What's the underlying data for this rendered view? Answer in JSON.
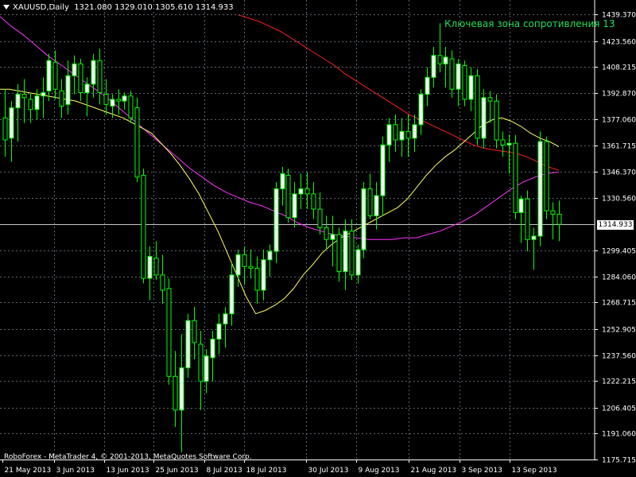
{
  "header": {
    "symbol": "XAUUSD,Daily",
    "ohlc": "1321.080 1329.010 1305.610 1314.933"
  },
  "annotation": "Ключевая зона сопротивления 13",
  "copyright": "RoboForex - MetaTrader 4, © 2001-2013, MetaQuotes Software Corp.",
  "colors": {
    "background": "#000000",
    "grid": "#5a6470",
    "bull_candle": "#ffffff",
    "bear_candle": "#000000",
    "wick": "#00ff00",
    "ma_fast": "#ffff66",
    "ma_mid": "#ff33ff",
    "ma_slow": "#ff2020",
    "annotation": "#22dd55"
  },
  "chart_data": {
    "type": "candlestick",
    "ylim": [
      1175.71,
      1439.37
    ],
    "current_price": "1314.933",
    "y_ticks": [
      "1439.370",
      "1423.560",
      "1408.215",
      "1392.870",
      "1377.060",
      "1361.715",
      "1346.370",
      "1330.560",
      "1314.933",
      "1299.405",
      "1284.060",
      "1268.715",
      "1252.905",
      "1237.560",
      "1222.215",
      "1206.405",
      "1191.060",
      "1175.715"
    ],
    "x_labels": [
      "21 May 2013",
      "3 Jun 2013",
      "13 Jun 2013",
      "25 Jun 2013",
      "8 Jul 2013",
      "18 Jul 2013",
      "30 Jul 2013",
      "9 Aug 2013",
      "21 Aug 2013",
      "3 Sep 2013",
      "13 Sep 2013"
    ],
    "candles": [
      {
        "o": 1378,
        "h": 1395,
        "l": 1355,
        "c": 1365
      },
      {
        "o": 1366,
        "h": 1388,
        "l": 1352,
        "c": 1384
      },
      {
        "o": 1384,
        "h": 1398,
        "l": 1364,
        "c": 1392
      },
      {
        "o": 1392,
        "h": 1401,
        "l": 1375,
        "c": 1390
      },
      {
        "o": 1389,
        "h": 1393,
        "l": 1375,
        "c": 1383
      },
      {
        "o": 1383,
        "h": 1395,
        "l": 1377,
        "c": 1391
      },
      {
        "o": 1391,
        "h": 1402,
        "l": 1378,
        "c": 1393
      },
      {
        "o": 1394,
        "h": 1416,
        "l": 1388,
        "c": 1412
      },
      {
        "o": 1411,
        "h": 1418,
        "l": 1389,
        "c": 1395
      },
      {
        "o": 1394,
        "h": 1401,
        "l": 1378,
        "c": 1385
      },
      {
        "o": 1386,
        "h": 1412,
        "l": 1380,
        "c": 1403
      },
      {
        "o": 1403,
        "h": 1415,
        "l": 1392,
        "c": 1410
      },
      {
        "o": 1410,
        "h": 1413,
        "l": 1388,
        "c": 1393
      },
      {
        "o": 1393,
        "h": 1402,
        "l": 1379,
        "c": 1398
      },
      {
        "o": 1398,
        "h": 1416,
        "l": 1390,
        "c": 1412
      },
      {
        "o": 1412,
        "h": 1419,
        "l": 1386,
        "c": 1393
      },
      {
        "o": 1392,
        "h": 1401,
        "l": 1380,
        "c": 1386
      },
      {
        "o": 1385,
        "h": 1392,
        "l": 1378,
        "c": 1389
      },
      {
        "o": 1389,
        "h": 1395,
        "l": 1380,
        "c": 1388
      },
      {
        "o": 1388,
        "h": 1393,
        "l": 1383,
        "c": 1391
      },
      {
        "o": 1391,
        "h": 1394,
        "l": 1375,
        "c": 1378
      },
      {
        "o": 1384,
        "h": 1390,
        "l": 1340,
        "c": 1343
      },
      {
        "o": 1344,
        "h": 1348,
        "l": 1280,
        "c": 1283
      },
      {
        "o": 1283,
        "h": 1302,
        "l": 1270,
        "c": 1296
      },
      {
        "o": 1295,
        "h": 1305,
        "l": 1282,
        "c": 1285
      },
      {
        "o": 1285,
        "h": 1297,
        "l": 1268,
        "c": 1276
      },
      {
        "o": 1277,
        "h": 1283,
        "l": 1220,
        "c": 1225
      },
      {
        "o": 1225,
        "h": 1240,
        "l": 1195,
        "c": 1205
      },
      {
        "o": 1205,
        "h": 1250,
        "l": 1180,
        "c": 1230
      },
      {
        "o": 1230,
        "h": 1262,
        "l": 1224,
        "c": 1258
      },
      {
        "o": 1258,
        "h": 1266,
        "l": 1235,
        "c": 1245
      },
      {
        "o": 1244,
        "h": 1252,
        "l": 1205,
        "c": 1222
      },
      {
        "o": 1222,
        "h": 1241,
        "l": 1215,
        "c": 1237
      },
      {
        "o": 1236,
        "h": 1252,
        "l": 1222,
        "c": 1247
      },
      {
        "o": 1247,
        "h": 1262,
        "l": 1238,
        "c": 1256
      },
      {
        "o": 1256,
        "h": 1266,
        "l": 1242,
        "c": 1262
      },
      {
        "o": 1262,
        "h": 1292,
        "l": 1255,
        "c": 1285
      },
      {
        "o": 1285,
        "h": 1300,
        "l": 1278,
        "c": 1297
      },
      {
        "o": 1297,
        "h": 1302,
        "l": 1279,
        "c": 1290
      },
      {
        "o": 1290,
        "h": 1300,
        "l": 1283,
        "c": 1289
      },
      {
        "o": 1289,
        "h": 1296,
        "l": 1268,
        "c": 1276
      },
      {
        "o": 1276,
        "h": 1300,
        "l": 1270,
        "c": 1294
      },
      {
        "o": 1294,
        "h": 1303,
        "l": 1284,
        "c": 1299
      },
      {
        "o": 1299,
        "h": 1340,
        "l": 1292,
        "c": 1336
      },
      {
        "o": 1336,
        "h": 1349,
        "l": 1326,
        "c": 1345
      },
      {
        "o": 1344,
        "h": 1348,
        "l": 1316,
        "c": 1319
      },
      {
        "o": 1319,
        "h": 1340,
        "l": 1313,
        "c": 1333
      },
      {
        "o": 1333,
        "h": 1345,
        "l": 1324,
        "c": 1336
      },
      {
        "o": 1336,
        "h": 1346,
        "l": 1324,
        "c": 1333
      },
      {
        "o": 1333,
        "h": 1340,
        "l": 1318,
        "c": 1324
      },
      {
        "o": 1324,
        "h": 1334,
        "l": 1309,
        "c": 1313
      },
      {
        "o": 1313,
        "h": 1320,
        "l": 1300,
        "c": 1306
      },
      {
        "o": 1306,
        "h": 1320,
        "l": 1290,
        "c": 1309
      },
      {
        "o": 1309,
        "h": 1313,
        "l": 1281,
        "c": 1287
      },
      {
        "o": 1287,
        "h": 1318,
        "l": 1276,
        "c": 1311
      },
      {
        "o": 1311,
        "h": 1318,
        "l": 1282,
        "c": 1285
      },
      {
        "o": 1285,
        "h": 1303,
        "l": 1280,
        "c": 1300
      },
      {
        "o": 1300,
        "h": 1340,
        "l": 1295,
        "c": 1336
      },
      {
        "o": 1336,
        "h": 1345,
        "l": 1318,
        "c": 1320
      },
      {
        "o": 1320,
        "h": 1340,
        "l": 1312,
        "c": 1332
      },
      {
        "o": 1332,
        "h": 1367,
        "l": 1320,
        "c": 1362
      },
      {
        "o": 1362,
        "h": 1378,
        "l": 1352,
        "c": 1374
      },
      {
        "o": 1374,
        "h": 1380,
        "l": 1358,
        "c": 1365
      },
      {
        "o": 1365,
        "h": 1378,
        "l": 1355,
        "c": 1370
      },
      {
        "o": 1370,
        "h": 1380,
        "l": 1355,
        "c": 1366
      },
      {
        "o": 1366,
        "h": 1380,
        "l": 1358,
        "c": 1374
      },
      {
        "o": 1374,
        "h": 1395,
        "l": 1368,
        "c": 1392
      },
      {
        "o": 1392,
        "h": 1408,
        "l": 1385,
        "c": 1402
      },
      {
        "o": 1402,
        "h": 1420,
        "l": 1396,
        "c": 1415
      },
      {
        "o": 1415,
        "h": 1434,
        "l": 1405,
        "c": 1410
      },
      {
        "o": 1410,
        "h": 1420,
        "l": 1396,
        "c": 1414
      },
      {
        "o": 1413,
        "h": 1418,
        "l": 1390,
        "c": 1395
      },
      {
        "o": 1395,
        "h": 1413,
        "l": 1385,
        "c": 1410
      },
      {
        "o": 1409,
        "h": 1412,
        "l": 1385,
        "c": 1389
      },
      {
        "o": 1389,
        "h": 1408,
        "l": 1382,
        "c": 1403
      },
      {
        "o": 1403,
        "h": 1407,
        "l": 1362,
        "c": 1366
      },
      {
        "o": 1366,
        "h": 1395,
        "l": 1360,
        "c": 1390
      },
      {
        "o": 1390,
        "h": 1394,
        "l": 1375,
        "c": 1388
      },
      {
        "o": 1388,
        "h": 1392,
        "l": 1360,
        "c": 1365
      },
      {
        "o": 1365,
        "h": 1370,
        "l": 1355,
        "c": 1362
      },
      {
        "o": 1362,
        "h": 1368,
        "l": 1345,
        "c": 1363
      },
      {
        "o": 1363,
        "h": 1368,
        "l": 1318,
        "c": 1322
      },
      {
        "o": 1322,
        "h": 1332,
        "l": 1304,
        "c": 1330
      },
      {
        "o": 1330,
        "h": 1335,
        "l": 1299,
        "c": 1306
      },
      {
        "o": 1306,
        "h": 1313,
        "l": 1288,
        "c": 1308
      },
      {
        "o": 1308,
        "h": 1370,
        "l": 1302,
        "c": 1364
      },
      {
        "o": 1364,
        "h": 1367,
        "l": 1318,
        "c": 1323
      },
      {
        "o": 1323,
        "h": 1328,
        "l": 1306,
        "c": 1321
      },
      {
        "o": 1321,
        "h": 1329,
        "l": 1305,
        "c": 1315
      }
    ],
    "ma_fast": [
      1395,
      1395,
      1394,
      1393,
      1392,
      1391,
      1390,
      1389,
      1388,
      1386,
      1384,
      1382,
      1380,
      1378,
      1375,
      1372,
      1369,
      1363,
      1357,
      1350,
      1342,
      1333,
      1322,
      1311,
      1298,
      1285,
      1272,
      1262,
      1264,
      1267,
      1271,
      1277,
      1285,
      1291,
      1298,
      1303,
      1307,
      1310,
      1313,
      1316,
      1319,
      1322,
      1325,
      1330,
      1337,
      1344,
      1350,
      1355,
      1359,
      1364,
      1369,
      1374,
      1377,
      1378,
      1376,
      1373,
      1369,
      1366,
      1364,
      1361
    ],
    "ma_mid": [
      1438,
      1432,
      1427,
      1421,
      1415,
      1410,
      1405,
      1400,
      1395,
      1390,
      1384,
      1378,
      1372,
      1366,
      1360,
      1354,
      1348,
      1343,
      1338,
      1334,
      1331,
      1328,
      1326,
      1323,
      1320,
      1316,
      1313,
      1311,
      1309,
      1308,
      1307,
      1306,
      1306,
      1306,
      1307,
      1307,
      1309,
      1311,
      1314,
      1317,
      1321,
      1326,
      1331,
      1336,
      1340,
      1343,
      1345,
      1346
    ],
    "ma_slow": [
      1439,
      1437,
      1435,
      1432,
      1429,
      1425,
      1421,
      1417,
      1413,
      1409,
      1404,
      1400,
      1396,
      1392,
      1388,
      1384,
      1380,
      1377,
      1374,
      1371,
      1368,
      1365,
      1362,
      1360,
      1359,
      1358,
      1357,
      1355,
      1352,
      1349,
      1347
    ]
  }
}
